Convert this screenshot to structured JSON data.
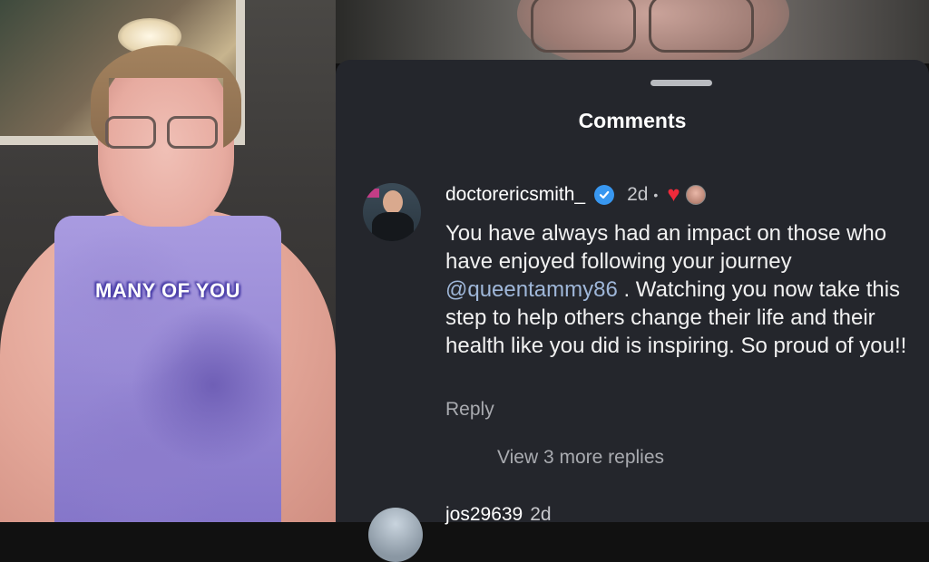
{
  "video": {
    "caption": "MANY OF YOU"
  },
  "comments_sheet": {
    "title": "Comments",
    "comment": {
      "username": "doctorericsmith_",
      "time": "2d",
      "separator": "•",
      "text_part1": "You have always had an impact on those who have enjoyed following your journey ",
      "mention": "@queentammy86",
      "text_part2": " .  Watching you now take this step to help others change their life and their health like you did is inspiring.  So proud of you!!",
      "reply_label": "Reply",
      "view_replies_label": "View 3 more replies"
    },
    "next_comment": {
      "username": "jos29639",
      "time": "2d"
    }
  },
  "colors": {
    "panel_bg": "#24262c",
    "verified_badge": "#3897f0",
    "heart": "#ee2a3a",
    "mention": "#9fb7d9"
  },
  "icons": [
    "verified-badge-icon",
    "heart-icon"
  ]
}
